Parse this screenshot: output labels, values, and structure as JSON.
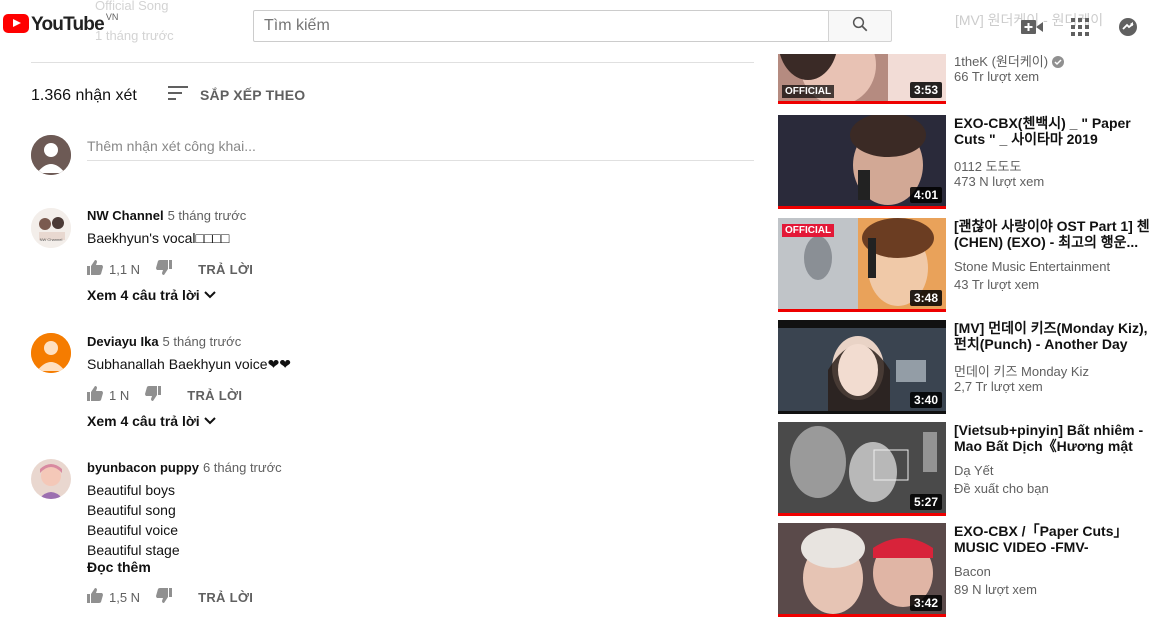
{
  "header": {
    "logo_text": "YouTube",
    "logo_country": "VN",
    "search_placeholder": "Tìm kiếm",
    "faded_text_1": "Official Song",
    "faded_text_2": "1 tháng trước",
    "faded_sidebar_title": "[MV] 원더케이 - 원더케이"
  },
  "comments_section": {
    "count_label": "1.366 nhận xét",
    "sort_label": "SẮP XẾP THEO",
    "add_placeholder": "Thêm nhận xét công khai...",
    "reply_label": "TRẢ LỜI",
    "comments": [
      {
        "author": "NW Channel",
        "time": "5 tháng trước",
        "text": "Baekhyun's vocal□□□□",
        "likes": "1,1 N",
        "view_replies": "Xem 4 câu trả lời"
      },
      {
        "author": "Deviayu Ika",
        "time": "5 tháng trước",
        "text": "Subhanallah Baekhyun voice❤❤",
        "likes": "1 N",
        "view_replies": "Xem 4 câu trả lời"
      },
      {
        "author": "byunbacon puppy",
        "time": "6 tháng trước",
        "lines": [
          "Beautiful boys",
          "Beautiful song",
          "Beautiful voice",
          "Beautiful stage"
        ],
        "read_more": "Đọc thêm",
        "likes": "1,5 N"
      }
    ]
  },
  "sidebar": {
    "videos": [
      {
        "title": "",
        "channel": "1theK (원더케이)",
        "views": "66 Tr lượt xem",
        "duration": "3:53",
        "badge": "OFFICIAL"
      },
      {
        "title": "EXO-CBX(첸백시) _ \" Paper Cuts \" _ 사이타마 2019",
        "channel": "0112 도도도",
        "views": "473 N lượt xem",
        "duration": "4:01"
      },
      {
        "title": "[괜찮아 사랑이야 OST Part 1] 첸 (CHEN) (EXO) - 최고의 행운...",
        "channel": "Stone Music Entertainment",
        "views": "43 Tr lượt xem",
        "duration": "3:48",
        "badge": "OFFICIAL"
      },
      {
        "title": "[MV] 먼데이 키즈(Monday Kiz), 펀치(Punch) - Another Day (tv...",
        "channel": "먼데이 키즈 Monday Kiz",
        "views": "2,7 Tr lượt xem",
        "duration": "3:40"
      },
      {
        "title": "[Vietsub+pinyin] Bất nhiêm - Mao Bất Dịch《Hương mật tự...",
        "channel": "Dạ Yết",
        "views": "Đề xuất cho bạn",
        "duration": "5:27"
      },
      {
        "title": "EXO-CBX /「Paper Cuts」 MUSIC VIDEO -FMV-",
        "channel": "Bacon",
        "views": "89 N lượt xem",
        "duration": "3:42"
      }
    ]
  },
  "colors": {
    "brand_red": "#ff0000",
    "progress_red": "#e00000",
    "secondary_text": "#606060"
  }
}
